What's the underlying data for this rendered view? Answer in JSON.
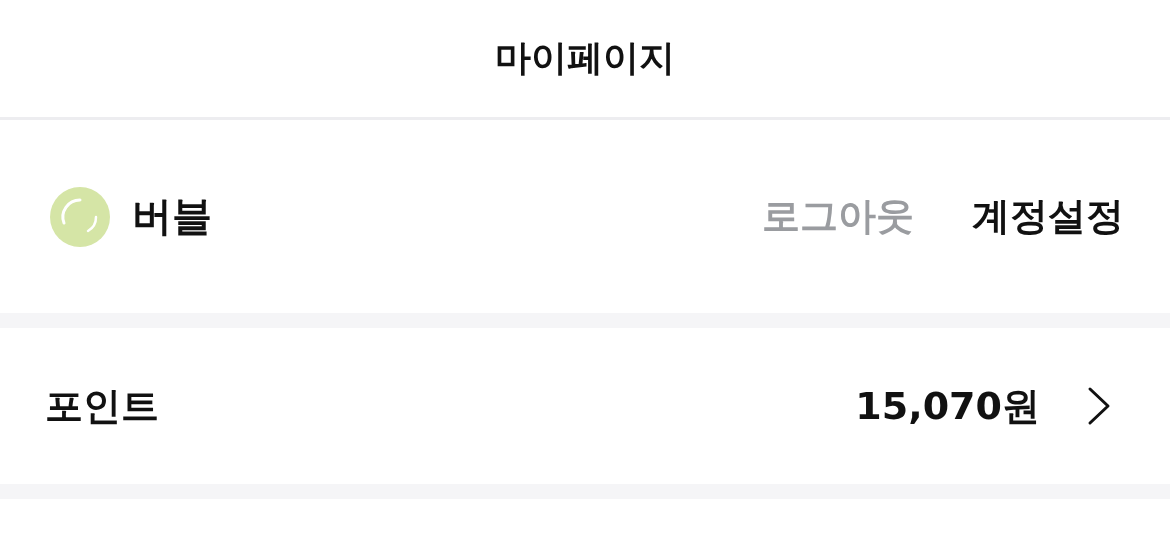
{
  "header": {
    "title": "마이페이지"
  },
  "profile": {
    "name": "버블",
    "logout": "로그아웃",
    "account_settings": "계정설정"
  },
  "points": {
    "label": "포인트",
    "value": "15,070원"
  }
}
